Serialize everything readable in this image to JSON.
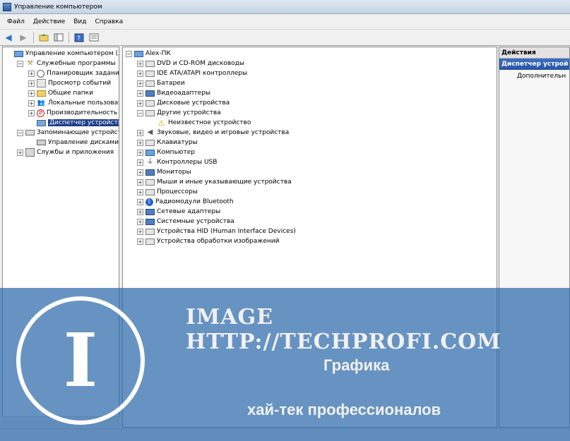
{
  "window": {
    "title": "Управление компьютером"
  },
  "menu": [
    "Файл",
    "Действие",
    "Вид",
    "Справка"
  ],
  "left_tree": [
    {
      "label": "Управление компьютером (лока",
      "level": 0,
      "expander": "",
      "icon": "computer-icon"
    },
    {
      "label": "Служебные программы",
      "level": 1,
      "expander": "−",
      "icon": "tools-icon"
    },
    {
      "label": "Планировщик заданий",
      "level": 2,
      "expander": "+",
      "icon": "clock-icon"
    },
    {
      "label": "Просмотр событий",
      "level": 2,
      "expander": "+",
      "icon": "event-log-icon"
    },
    {
      "label": "Общие папки",
      "level": 2,
      "expander": "+",
      "icon": "folder-icon"
    },
    {
      "label": "Локальные пользовател",
      "level": 2,
      "expander": "+",
      "icon": "users-icon"
    },
    {
      "label": "Производительность",
      "level": 2,
      "expander": "+",
      "icon": "performance-icon"
    },
    {
      "label": "Диспетчер устройств",
      "level": 2,
      "expander": "",
      "icon": "device-manager-icon",
      "selected": true
    },
    {
      "label": "Запоминающие устройства",
      "level": 1,
      "expander": "−",
      "icon": "storage-icon"
    },
    {
      "label": "Управление дисками",
      "level": 2,
      "expander": "",
      "icon": "disk-icon"
    },
    {
      "label": "Службы и приложения",
      "level": 1,
      "expander": "+",
      "icon": "services-icon"
    }
  ],
  "device_tree": {
    "root": "Alex-ПК",
    "items": [
      {
        "label": "DVD и CD-ROM дисководы",
        "expander": "+",
        "icon": "dvd-icon"
      },
      {
        "label": "IDE ATA/ATAPI контроллеры",
        "expander": "+",
        "icon": "ide-controller-icon"
      },
      {
        "label": "Батареи",
        "expander": "+",
        "icon": "battery-icon"
      },
      {
        "label": "Видеоадаптеры",
        "expander": "+",
        "icon": "display-adapter-icon"
      },
      {
        "label": "Дисковые устройства",
        "expander": "+",
        "icon": "disk-drive-icon"
      },
      {
        "label": "Другие устройства",
        "expander": "−",
        "icon": "other-devices-icon"
      },
      {
        "label": "Неизвестное устройство",
        "expander": "",
        "icon": "unknown-device-warning-icon",
        "child": true
      },
      {
        "label": "Звуковые, видео и игровые устройства",
        "expander": "+",
        "icon": "sound-icon"
      },
      {
        "label": "Клавиатуры",
        "expander": "+",
        "icon": "keyboard-icon"
      },
      {
        "label": "Компьютер",
        "expander": "+",
        "icon": "computer-icon"
      },
      {
        "label": "Контроллеры USB",
        "expander": "+",
        "icon": "usb-icon"
      },
      {
        "label": "Мониторы",
        "expander": "+",
        "icon": "monitor-icon"
      },
      {
        "label": "Мыши и иные указывающие устройства",
        "expander": "+",
        "icon": "mouse-icon"
      },
      {
        "label": "Процессоры",
        "expander": "+",
        "icon": "processor-icon"
      },
      {
        "label": "Радиомодули Bluetooth",
        "expander": "+",
        "icon": "bluetooth-icon"
      },
      {
        "label": "Сетевые адаптеры",
        "expander": "+",
        "icon": "network-adapter-icon"
      },
      {
        "label": "Системные устройства",
        "expander": "+",
        "icon": "system-devices-icon"
      },
      {
        "label": "Устройства HID (Human Interface Devices)",
        "expander": "+",
        "icon": "hid-icon"
      },
      {
        "label": "Устройства обработки изображений",
        "expander": "+",
        "icon": "imaging-devices-icon"
      }
    ]
  },
  "actions": {
    "header": "Действия",
    "title": "Диспетчер устрой",
    "more": "Дополнительн"
  },
  "watermark": {
    "url": "IMAGE HTTP://TECHPROFI.COM",
    "line1": "Графика",
    "line2": "хай-тек профессионалов",
    "logo_letter": "I"
  },
  "colors": {
    "selection": "#1c3e8a",
    "overlay": "#2d69aa",
    "actions_title": "#2854a3"
  }
}
